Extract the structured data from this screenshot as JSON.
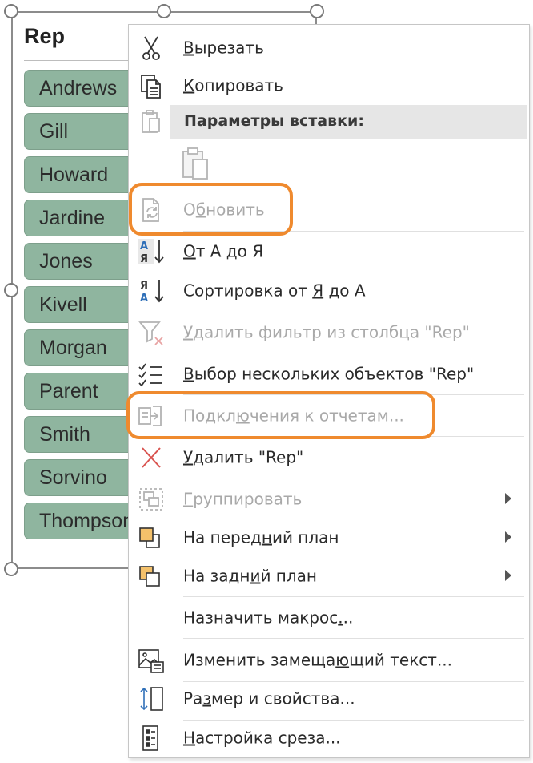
{
  "slicer": {
    "title": "Rep",
    "items": [
      "Andrews",
      "Gill",
      "Howard",
      "Jardine",
      "Jones",
      "Kivell",
      "Morgan",
      "Parent",
      "Smith",
      "Sorvino",
      "Thompson"
    ]
  },
  "menu": {
    "cut": {
      "u": "В",
      "rest": "ырезать"
    },
    "copy": {
      "u": "К",
      "rest": "опировать"
    },
    "paste_options": "Параметры вставки:",
    "refresh": {
      "pre": "О",
      "u": "б",
      "rest": "новить"
    },
    "sort_az": {
      "u": "О",
      "rest": "т А до Я"
    },
    "sort_za": {
      "pre": "Сортировка от ",
      "u": "Я",
      "rest": " до А"
    },
    "clear_filter": {
      "u": "У",
      "rest": "далить фильтр из столбца \"Rep\""
    },
    "multi_select": {
      "u": "В",
      "rest": "ыбор нескольких объектов \"Rep\""
    },
    "report_connections": {
      "pre": "Подкл",
      "u": "ю",
      "rest": "чения к отчетам..."
    },
    "remove": {
      "u": "У",
      "rest": "далить \"Rep\""
    },
    "group": {
      "u": "Г",
      "rest": "руппировать"
    },
    "bring_front": {
      "pre": "На перед",
      "u": "н",
      "rest": "ий план"
    },
    "send_back": {
      "pre": "На задн",
      "u": "и",
      "rest": "й план"
    },
    "assign_macro": {
      "pre": "Назначить макрос",
      "u": ".",
      "rest": ".."
    },
    "alt_text": {
      "pre": "Изменить замеща",
      "u": "ю",
      "rest": "щий текст..."
    },
    "size_props": {
      "pre": "Ра",
      "u": "з",
      "rest": "мер и свойства..."
    },
    "slicer_settings": {
      "pre": "",
      "u": "Н",
      "rest": "астройка среза..."
    }
  },
  "colors": {
    "slicer_item_fill": "#8fb59f",
    "highlight": "#ef8a2e",
    "disabled_text": "#a9a9a9"
  }
}
